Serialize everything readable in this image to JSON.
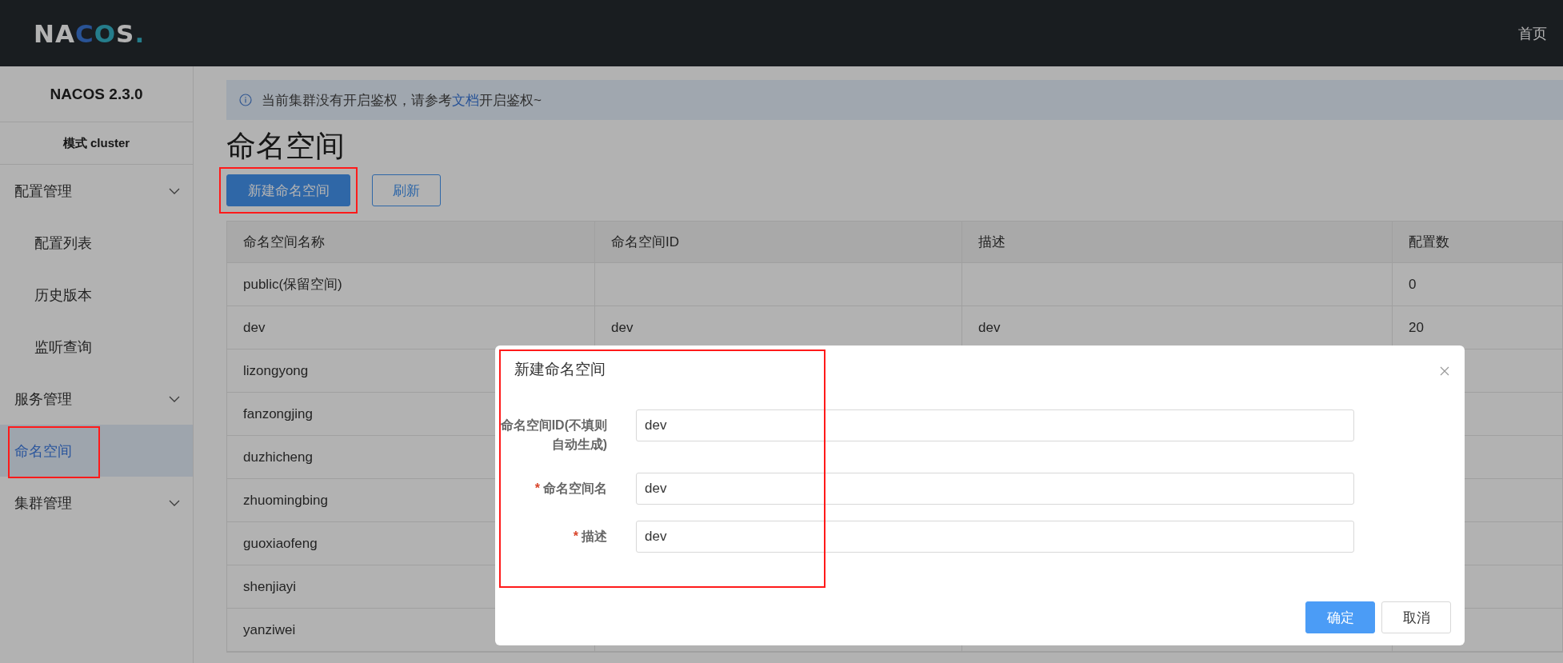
{
  "header": {
    "logo": "NACOS.",
    "nav_link": "首页"
  },
  "sidebar": {
    "title": "NACOS 2.3.0",
    "mode": "模式 cluster",
    "items": [
      {
        "label": "配置管理",
        "kind": "group",
        "selected": false,
        "children": [
          {
            "label": "配置列表",
            "kind": "item",
            "selected": false
          },
          {
            "label": "历史版本",
            "kind": "item",
            "selected": false
          },
          {
            "label": "监听查询",
            "kind": "item",
            "selected": false
          }
        ]
      },
      {
        "label": "服务管理",
        "kind": "group",
        "selected": false
      },
      {
        "label": "命名空间",
        "kind": "item",
        "selected": true,
        "highlighted": true
      },
      {
        "label": "集群管理",
        "kind": "group",
        "selected": false
      }
    ]
  },
  "notice": {
    "before": "当前集群没有开启鉴权，请参考",
    "link": "文档",
    "after": "开启鉴权~"
  },
  "page_title": "命名空间",
  "buttons": [
    {
      "label": "新建命名空间",
      "kind": "primary",
      "highlighted": true
    },
    {
      "label": "刷新",
      "kind": "secondary"
    }
  ],
  "table": {
    "columns": [
      "命名空间名称",
      "命名空间ID",
      "描述",
      "配置数"
    ],
    "rows": [
      {
        "cells": [
          "public(保留空间)",
          null,
          null,
          "0"
        ]
      },
      {
        "cells": [
          "dev",
          "dev",
          "dev",
          "20"
        ]
      },
      {
        "cells": [
          "lizongyong"
        ]
      },
      {
        "cells": [
          "fanzongjing"
        ]
      },
      {
        "cells": [
          "duzhicheng"
        ]
      },
      {
        "cells": [
          "zhuomingbing"
        ]
      },
      {
        "cells": [
          "guoxiaofeng"
        ]
      },
      {
        "cells": [
          "shenjiayi"
        ]
      },
      {
        "cells": [
          "yanziwei"
        ]
      }
    ]
  },
  "dialog": {
    "title": "新建命名空间",
    "highlighted": true,
    "fields": [
      {
        "label": "命名空间ID(不填则自动生成)",
        "value": "dev"
      },
      {
        "required_mark": "*",
        "label": "命名空间名",
        "value": "dev"
      },
      {
        "required_mark": "*",
        "label": "描述",
        "value": "dev"
      }
    ],
    "buttons": [
      {
        "label": "确定",
        "kind": "primary"
      },
      {
        "label": "取消",
        "kind": "secondary"
      }
    ]
  }
}
